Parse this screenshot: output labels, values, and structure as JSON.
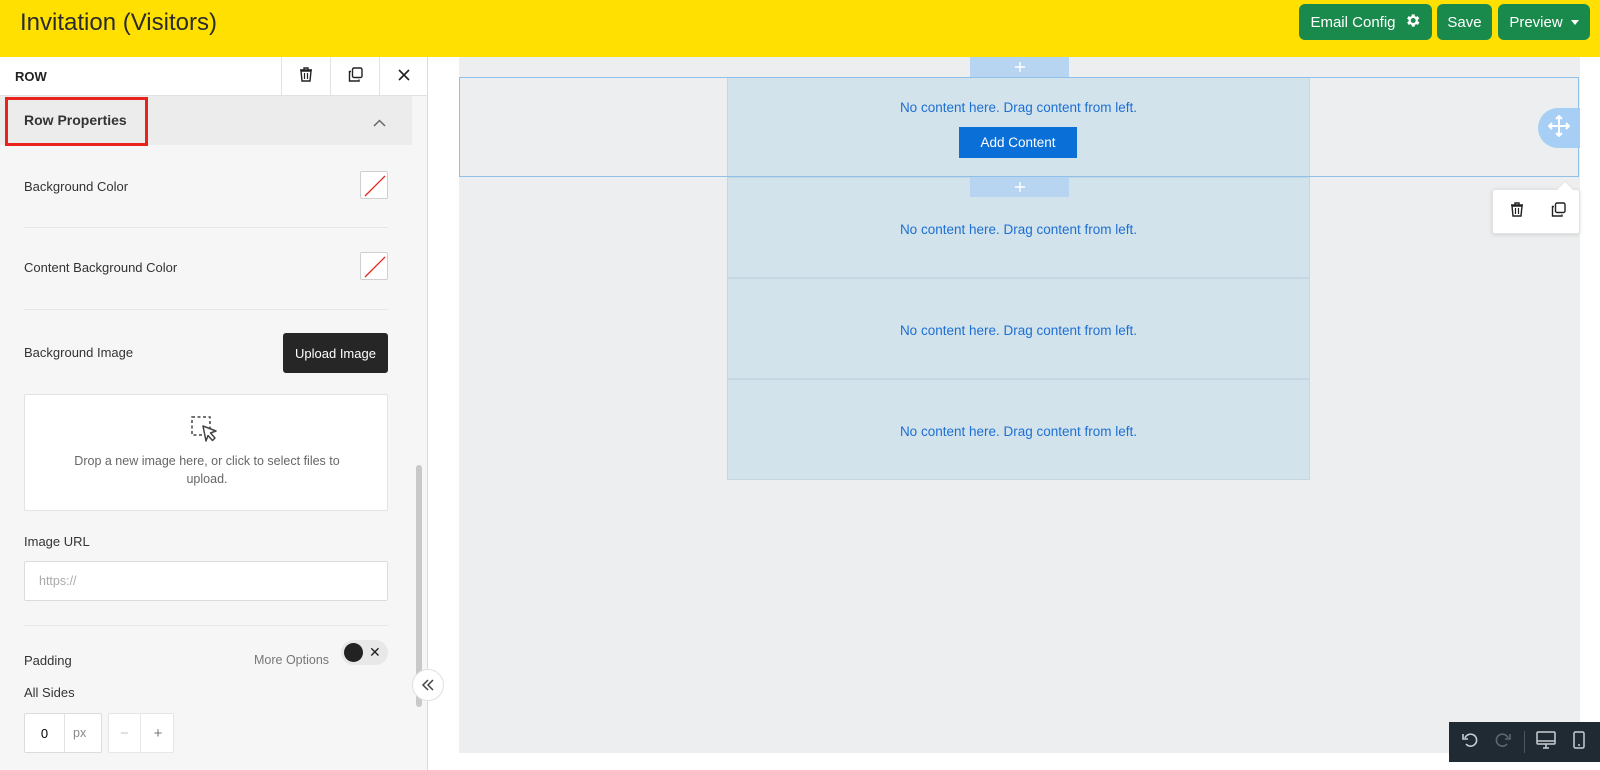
{
  "header": {
    "title": "Invitation (Visitors)",
    "email_config_label": "Email Config",
    "save_label": "Save",
    "preview_label": "Preview",
    "background_color": "#ffe000",
    "button_color": "#1a8a4c"
  },
  "panel": {
    "heading": "ROW",
    "toolbar_icons": [
      "trash-icon",
      "duplicate-icon",
      "close-icon"
    ],
    "section_title": "Row Properties",
    "background_color_label": "Background Color",
    "content_background_color_label": "Content Background Color",
    "background_image_label": "Background Image",
    "upload_button_label": "Upload Image",
    "dropzone_text": "Drop a new image here, or click to select files to upload.",
    "image_url_label": "Image URL",
    "image_url_placeholder": "https://",
    "padding_label": "Padding",
    "more_options_label": "More Options",
    "all_sides_label": "All Sides",
    "padding_value": "0",
    "padding_unit": "px",
    "stepper_minus": "−",
    "stepper_plus": "+"
  },
  "canvas": {
    "empty_message": "No content here. Drag content from left.",
    "add_content_label": "Add Content",
    "block_count": 4,
    "accent_color": "#0b6fd8"
  },
  "bottom_toolbar": {
    "icons": [
      "undo-icon",
      "redo-icon",
      "desktop-view-icon",
      "mobile-view-icon"
    ]
  }
}
